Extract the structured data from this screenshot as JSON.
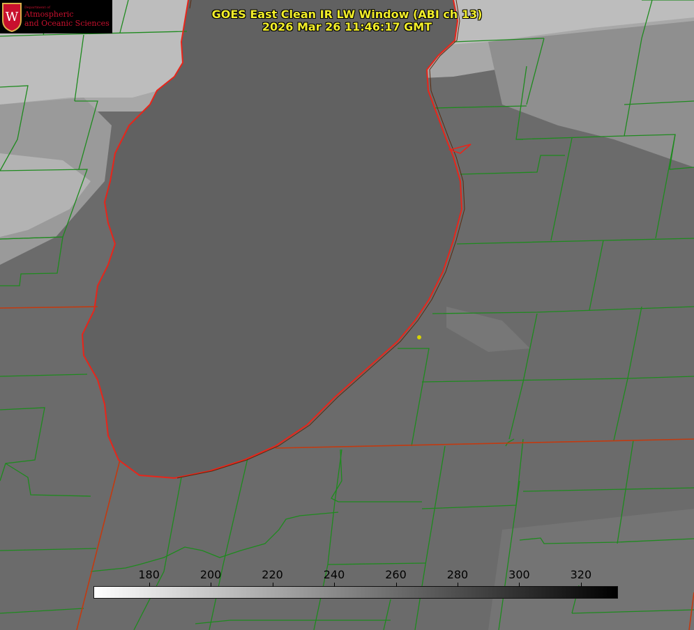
{
  "title": {
    "line1": "GOES East Clean IR LW Window (ABI ch 13)",
    "line2": "2026 Mar 26 11:46:17 GMT"
  },
  "logo": {
    "department": "Department of",
    "line1": "Atmospheric",
    "line2": "and Oceanic Sciences",
    "crest_letter": "W"
  },
  "colorbar": {
    "ticks": [
      "180",
      "200",
      "220",
      "240",
      "260",
      "280",
      "300",
      "320"
    ],
    "range": [
      162,
      332
    ],
    "start_color": "#ffffff",
    "end_color": "#000000"
  },
  "colors": {
    "county_lines": "#1e8a1e",
    "state_lines": "#c23a10",
    "lake_outline": "#e8251a",
    "marker": "#d6d200",
    "title_text": "#f2ee2a",
    "logo_red": "#c8102e"
  }
}
